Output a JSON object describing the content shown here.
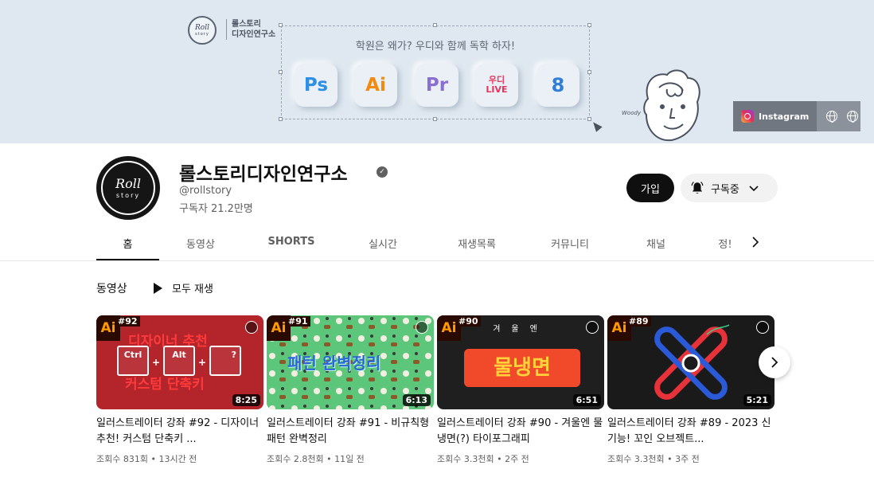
{
  "banner": {
    "brand_line1": "롤스토리",
    "brand_line2": "디자인연구소",
    "logo_top": "Roll",
    "logo_bottom": "story",
    "slogan": "학원은 왜가? 우디와 함께 독학 하자!",
    "tiles": [
      {
        "label": "Ps",
        "icon": "photoshop-icon"
      },
      {
        "label": "Ai",
        "icon": "illustrator-icon"
      },
      {
        "label": "Pr",
        "icon": "premiere-icon"
      },
      {
        "label_top": "우디",
        "label_bottom": "LIVE",
        "icon": "woody-live-icon"
      },
      {
        "label": "8",
        "icon": "person-icon"
      }
    ],
    "character_signature": "Woody",
    "links": {
      "instagram": "Instagram"
    }
  },
  "channel": {
    "name": "롤스토리디자인연구소",
    "handle": "@rollstory",
    "subscribers": "구독자 21.2만명",
    "avatar_top": "Roll",
    "avatar_bottom": "story",
    "join_label": "가입",
    "subscribed_label": "구독중"
  },
  "tabs": [
    "홈",
    "동영상",
    "SHORTS",
    "실시간",
    "재생목록",
    "커뮤니티",
    "채널",
    "정!"
  ],
  "section": {
    "title": "동영상",
    "play_all": "모두 재생"
  },
  "videos": [
    {
      "episode": "#92",
      "badge": "Ai",
      "duration": "8:25",
      "thumb_text_top": "디자이너 추천",
      "thumb_text_bottom": "커스텀 단축키",
      "keys": [
        "Ctrl",
        "Alt",
        "?"
      ],
      "title": "일러스트레이터 강좌 #92 - 디자이너 추천! 커스텀 단축키 ...",
      "meta": "조회수 831회 • 13시간 전"
    },
    {
      "episode": "#91",
      "badge": "Ai",
      "duration": "6:13",
      "thumb_text": "패턴 완벽정리",
      "title": "일러스트레이터 강좌 #91 - 비규칙형 패턴 완벽정리",
      "meta": "조회수 2.8천회 • 11일 전"
    },
    {
      "episode": "#90",
      "badge": "Ai",
      "duration": "6:51",
      "thumb_text_top": "겨울엔",
      "thumb_text": "물냉면",
      "title": "일러스트레이터 강좌 #90 - 겨울엔 물냉면(?) 타이포그래피",
      "meta": "조회수 3.3천회 • 2주 전"
    },
    {
      "episode": "#89",
      "badge": "Ai",
      "duration": "5:21",
      "title": "일러스트레이터 강좌 #89 - 2023 신기능! 꼬인 오브젝트...",
      "meta": "조회수 3.3천회 • 3주 전"
    }
  ],
  "colors": {
    "banner_bg": "#dfe8f0",
    "button_dark": "#0f0f0f",
    "button_light": "#f2f2f2",
    "secondary_text": "#606060",
    "illustrator_orange": "#ff9a00"
  }
}
